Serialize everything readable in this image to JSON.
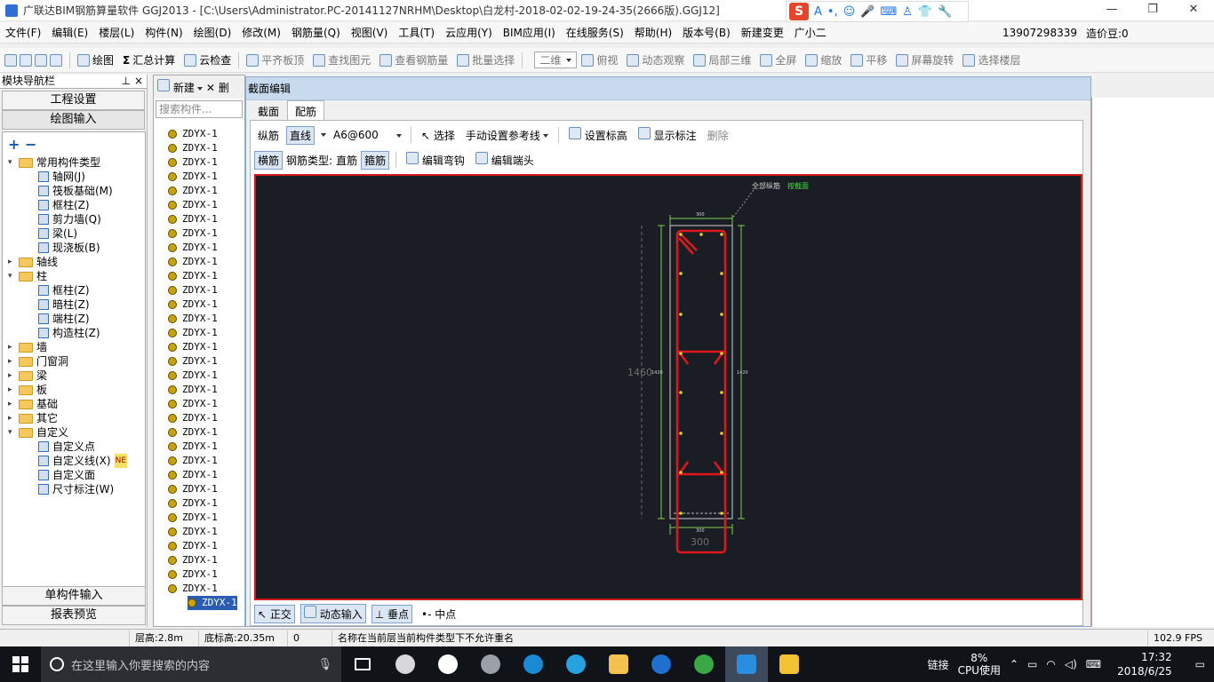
{
  "window": {
    "title": "广联达BIM钢筋算量软件 GGJ2013 - [C:\\Users\\Administrator.PC-20141127NRHM\\Desktop\\白龙村-2018-02-02-19-24-35(2666版).GGJ12]",
    "minimize": "—",
    "maximize": "❐",
    "close": "✕"
  },
  "ime": {
    "logo": "S",
    "items": [
      "A",
      "•,",
      "☺",
      "🎤",
      "⌨",
      "♙",
      "👕",
      "🔧"
    ]
  },
  "menu": {
    "items": [
      "文件(F)",
      "编辑(E)",
      "楼层(L)",
      "构件(N)",
      "绘图(D)",
      "修改(M)",
      "钢筋量(Q)",
      "视图(V)",
      "工具(T)",
      "云应用(Y)",
      "BIM应用(I)",
      "在线服务(S)",
      "帮助(H)",
      "版本号(B)",
      "新建变更",
      "广小二"
    ],
    "phone": "13907298339",
    "price_bean": "造价豆:0"
  },
  "toolbar": {
    "items": [
      "绘图",
      "汇总计算",
      "云检查",
      "平齐板顶",
      "查找图元",
      "查看钢筋量",
      "批量选择"
    ],
    "view_mode": "二维",
    "view_items": [
      "俯视",
      "动态观察",
      "局部三维",
      "全屏",
      "缩放",
      "平移",
      "屏幕旋转",
      "选择楼层"
    ]
  },
  "nav": {
    "title": "模块导航栏",
    "pin": "⊥",
    "close": "×",
    "btn_engineering": "工程设置",
    "btn_drawing": "绘图输入",
    "btn_single": "单构件输入",
    "btn_report": "报表预览",
    "tree": [
      {
        "label": "常用构件类型",
        "level": 0,
        "type": "folder",
        "open": true
      },
      {
        "label": "轴网(J)",
        "level": 1,
        "type": "item"
      },
      {
        "label": "筏板基础(M)",
        "level": 1,
        "type": "item"
      },
      {
        "label": "框柱(Z)",
        "level": 1,
        "type": "item"
      },
      {
        "label": "剪力墙(Q)",
        "level": 1,
        "type": "item"
      },
      {
        "label": "梁(L)",
        "level": 1,
        "type": "item"
      },
      {
        "label": "现浇板(B)",
        "level": 1,
        "type": "item"
      },
      {
        "label": "轴线",
        "level": 0,
        "type": "folder",
        "open": false
      },
      {
        "label": "柱",
        "level": 0,
        "type": "folder",
        "open": true
      },
      {
        "label": "框柱(Z)",
        "level": 1,
        "type": "item"
      },
      {
        "label": "暗柱(Z)",
        "level": 1,
        "type": "item"
      },
      {
        "label": "端柱(Z)",
        "level": 1,
        "type": "item"
      },
      {
        "label": "构造柱(Z)",
        "level": 1,
        "type": "item"
      },
      {
        "label": "墙",
        "level": 0,
        "type": "folder",
        "open": false
      },
      {
        "label": "门窗洞",
        "level": 0,
        "type": "folder",
        "open": false
      },
      {
        "label": "梁",
        "level": 0,
        "type": "folder",
        "open": false
      },
      {
        "label": "板",
        "level": 0,
        "type": "folder",
        "open": false
      },
      {
        "label": "基础",
        "level": 0,
        "type": "folder",
        "open": false
      },
      {
        "label": "其它",
        "level": 0,
        "type": "folder",
        "open": false
      },
      {
        "label": "自定义",
        "level": 0,
        "type": "folder",
        "open": true
      },
      {
        "label": "自定义点",
        "level": 1,
        "type": "item"
      },
      {
        "label": "自定义线(X)",
        "level": 1,
        "type": "item",
        "badge": "NE"
      },
      {
        "label": "自定义面",
        "level": 1,
        "type": "item"
      },
      {
        "label": "尺寸标注(W)",
        "level": 1,
        "type": "item"
      }
    ]
  },
  "components": {
    "new_label": "新建",
    "delete_label": "删",
    "search_placeholder": "搜索构件...",
    "item_label": "ZDYX-1",
    "count": 34
  },
  "dialog": {
    "title": "截面编辑",
    "tabs": [
      "截面",
      "配筋"
    ],
    "row1": {
      "longitudinal": "纵筋",
      "straight": "直线",
      "spec": "A6@600",
      "select": "选择",
      "ref_line": "手动设置参考线",
      "set_elev": "设置标高",
      "show_mark": "显示标注",
      "delete": "删除"
    },
    "row2": {
      "transverse": "横筋",
      "rebar_type_label": "钢筋类型:",
      "rebar_type": "直筋",
      "stirrup": "箍筋",
      "edit_hook": "编辑弯钩",
      "edit_end": "编辑端头"
    },
    "drawing": {
      "note_left": "全部纵筋",
      "note_right": "按截面",
      "top_dim": "300",
      "left_dim": "1460",
      "left_small": "1420",
      "right_small": "1420",
      "bottom_small": "300",
      "bottom_dim": "300",
      "colors": {
        "bg": "#1b1d24",
        "rebar": "#e0181b",
        "dim": "#7bd14f",
        "point": "#e9d12a"
      }
    },
    "bottom": {
      "ortho": "正交",
      "dynamic": "动态输入",
      "perp": "垂点",
      "mid": "中点"
    }
  },
  "status": {
    "floor_height": "层高:2.8m",
    "bottom_elev": "底标高:20.35m",
    "zero": "0",
    "message": "名称在当前层当前构件类型下不允许重名",
    "fps": "102.9 FPS"
  },
  "taskbar": {
    "search_placeholder": "在这里输入你要搜索的内容",
    "link": "链接",
    "cpu_pct": "8%",
    "cpu_label": "CPU使用",
    "time": "17:32",
    "date": "2018/6/25"
  }
}
